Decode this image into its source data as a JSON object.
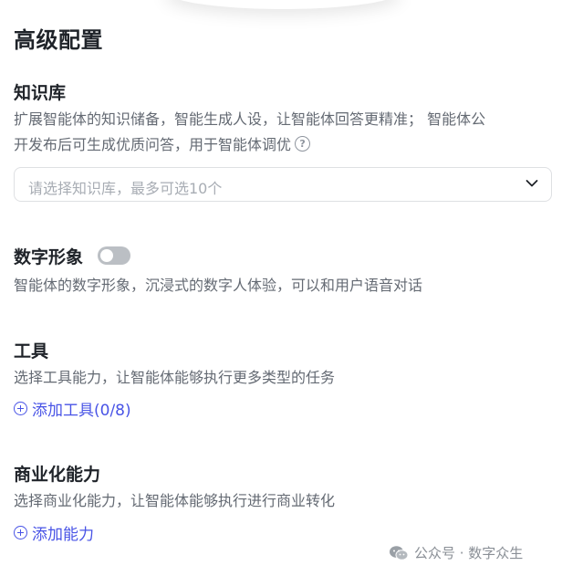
{
  "page_title": "高级配置",
  "knowledge": {
    "title": "知识库",
    "desc_line1": "扩展智能体的知识储备，智能生成人设，让智能体回答更精准； 智能体公",
    "desc_line2": "开发布后可生成优质问答，用于智能体调优",
    "help_icon": "?",
    "select_placeholder": "请选择知识库，最多可选10个"
  },
  "digital_human": {
    "title": "数字形象",
    "toggle_on": false,
    "desc": "智能体的数字形象，沉浸式的数字人体验，可以和用户语音对话"
  },
  "tools": {
    "title": "工具",
    "desc": "选择工具能力，让智能体能够执行更多类型的任务",
    "add_label": "添加工具(0/8)"
  },
  "commerce": {
    "title": "商业化能力",
    "desc": "选择商业化能力，让智能体能够执行进行商业转化",
    "add_label": "添加能力"
  },
  "watermark": "公众号 · 数字众生",
  "colors": {
    "accent": "#4954e6",
    "text_primary": "#1f2329",
    "text_secondary": "#646a73",
    "toggle_off": "#bbbfc4"
  }
}
